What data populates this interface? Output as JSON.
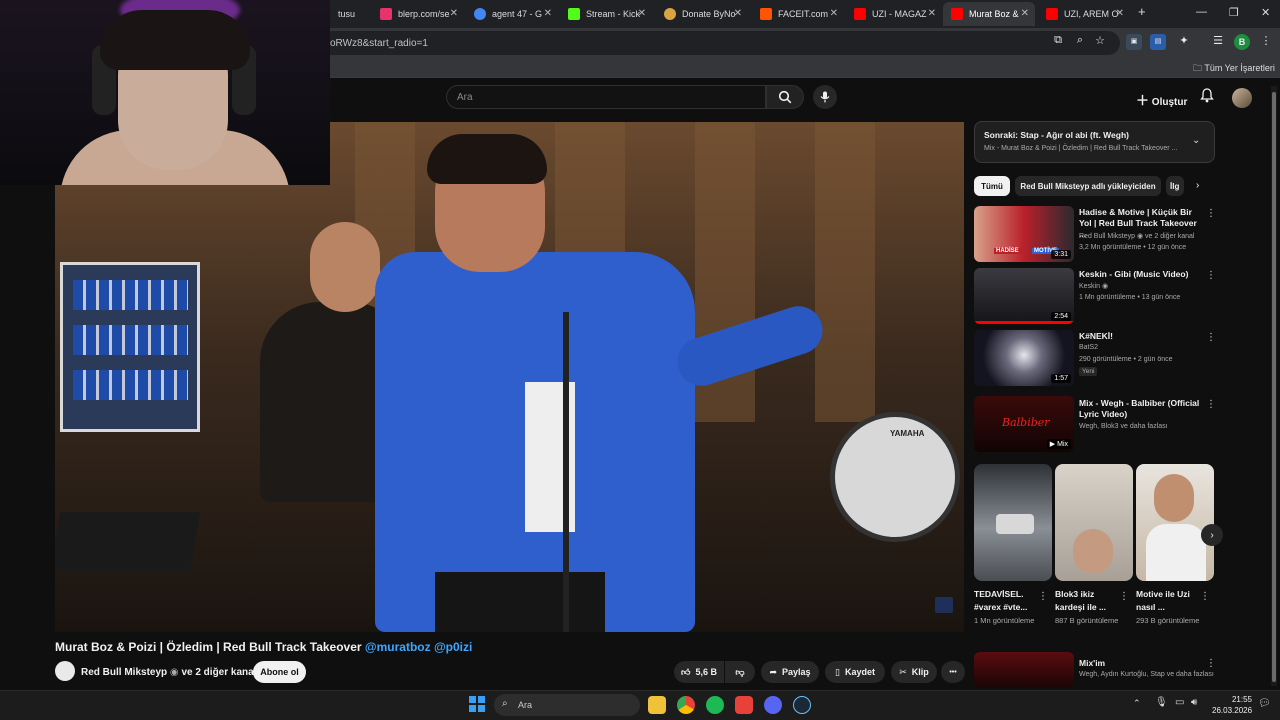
{
  "browser": {
    "tabs": [
      {
        "label": "tusu",
        "color": "#777777"
      },
      {
        "label": "blerp.com/se",
        "color": "#e8326b"
      },
      {
        "label": "agent 47 - G",
        "color": "#4285f4"
      },
      {
        "label": "Stream - Kick",
        "color": "#53fc18"
      },
      {
        "label": "Donate ByNo",
        "color": "#d9a441"
      },
      {
        "label": "FACEIT.com",
        "color": "#ff5500"
      },
      {
        "label": "UZI - MAGAZ",
        "color": "#ff0000"
      },
      {
        "label": "Murat Boz & ",
        "color": "#ff0000"
      },
      {
        "label": "UZI, AREM O",
        "color": "#ff0000"
      }
    ],
    "new_tab": "+",
    "url": "oRWz8&start_radio=1",
    "bookmarks_label": "Tüm Yer İşaretleri",
    "profile_letter": "B"
  },
  "youtube": {
    "search_placeholder": "Ara",
    "create_label": "Oluştur",
    "video": {
      "title": "Murat Boz & Poizi | Özledim | Red Bull Track Takeover",
      "mentions": "@muratboz @p0izi",
      "channel": "Red Bull Miksteyp",
      "channel_extra": "ve 2 diğer kanal",
      "subscribe": "Abone ol",
      "likes": "5,6 B",
      "share": "Paylaş",
      "save": "Kaydet",
      "clip": "Klip",
      "more": "•••",
      "drum_brand": "YAMAHA"
    },
    "up_next": {
      "title": "Sonraki: Stap - Ağır ol abi (ft. Wegh)",
      "subtitle": "Mix - Murat Boz & Poizi | Özledim | Red Bull Track Takeover ..."
    },
    "chips": [
      "Tümü",
      "Red Bull Miksteyp adlı yükleyiciden",
      "İlg"
    ],
    "recommendations": [
      {
        "title": "Hadise & Motive | Küçük Bir Yol | Red Bull Track Takeover ...",
        "channel": "Red Bull Miksteyp",
        "channel_extra": "ve 2 diğer kanal",
        "meta": "3,2 Mn görüntüleme • 12 gün önce",
        "duration": "3:31",
        "thumb_color": "#b9202a",
        "thumb_text": "HADİSE MOTİVE"
      },
      {
        "title": "Keskin - Gibi (Music Video)",
        "channel": "Keskin",
        "meta": "1 Mn görüntüleme • 13 gün önce",
        "duration": "2:54",
        "thumb_color": "#2a2a2e"
      },
      {
        "title": "K#NEKİ!",
        "channel": "BatS2",
        "meta": "290 görüntüleme • 2 gün önce",
        "badge": "Yeni",
        "duration": "1:57",
        "thumb_color": "#4a4a58"
      },
      {
        "title": "Mix - Wegh - Balbiber (Official Lyric Video)",
        "channel": "Wegh, Blok3 ve daha fazlası",
        "meta": "",
        "duration": "Mix",
        "thumb_color": "#2a0b0b",
        "thumb_text": "Balbiber"
      }
    ],
    "shorts": [
      {
        "title": "TEDAVİSEL. #varex #vte...",
        "meta": "1 Mn görüntüleme",
        "color": "#7a7f86"
      },
      {
        "title": "Blok3 ikiz kardeşi ile ...",
        "meta": "887 B görüntüleme",
        "color": "#b8b2aa"
      },
      {
        "title": "Motive ile Uzi nasıl ...",
        "meta": "293 B görüntüleme",
        "color": "#a88a6e"
      }
    ],
    "mix_last": {
      "title": "Mix'im",
      "meta": "Wegh, Aydın Kurtoğlu, Stap ve daha fazlası"
    }
  },
  "taskbar": {
    "search": "Ara",
    "time": "21:55",
    "date": "26.03.2026",
    "apps": [
      "#f0c239",
      "#1db954",
      "#e7413a",
      "#5865f2",
      "#1b2838"
    ]
  }
}
